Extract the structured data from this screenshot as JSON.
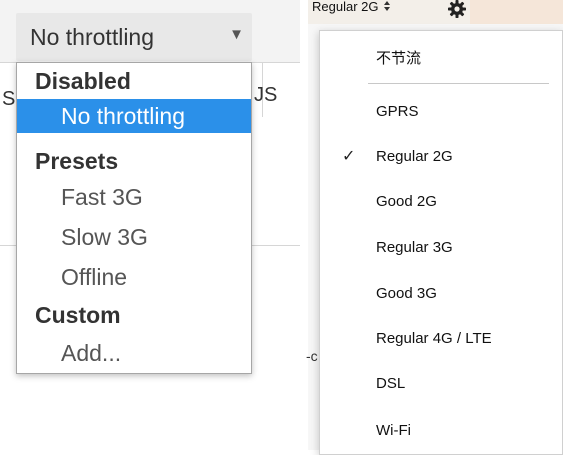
{
  "left": {
    "select_label": "No throttling",
    "select_arrow": "▼",
    "bg_fragments": [
      "S",
      "JS"
    ],
    "dropdown": {
      "groups": [
        {
          "label": "Disabled",
          "options": [
            {
              "label": "No throttling",
              "selected": true
            }
          ]
        },
        {
          "label": "Presets",
          "options": [
            {
              "label": "Fast 3G"
            },
            {
              "label": "Slow 3G"
            },
            {
              "label": "Offline"
            }
          ]
        },
        {
          "label": "Custom",
          "options": [
            {
              "label": "Add..."
            }
          ]
        }
      ]
    },
    "colors": {
      "selected_bg": "#2b90e9",
      "selected_fg": "#ffffff"
    }
  },
  "right": {
    "select_label": "Regular 2G",
    "select_icon": "updown-chevron-icon",
    "gear_icon": "gear-icon",
    "side_fragment": "-c",
    "menu": {
      "items": [
        "不节流",
        "GPRS",
        "Regular 2G",
        "Good 2G",
        "Regular 3G",
        "Good 3G",
        "Regular 4G / LTE",
        "DSL",
        "Wi-Fi"
      ],
      "checked": "Regular 2G",
      "check_glyph": "✓"
    }
  }
}
